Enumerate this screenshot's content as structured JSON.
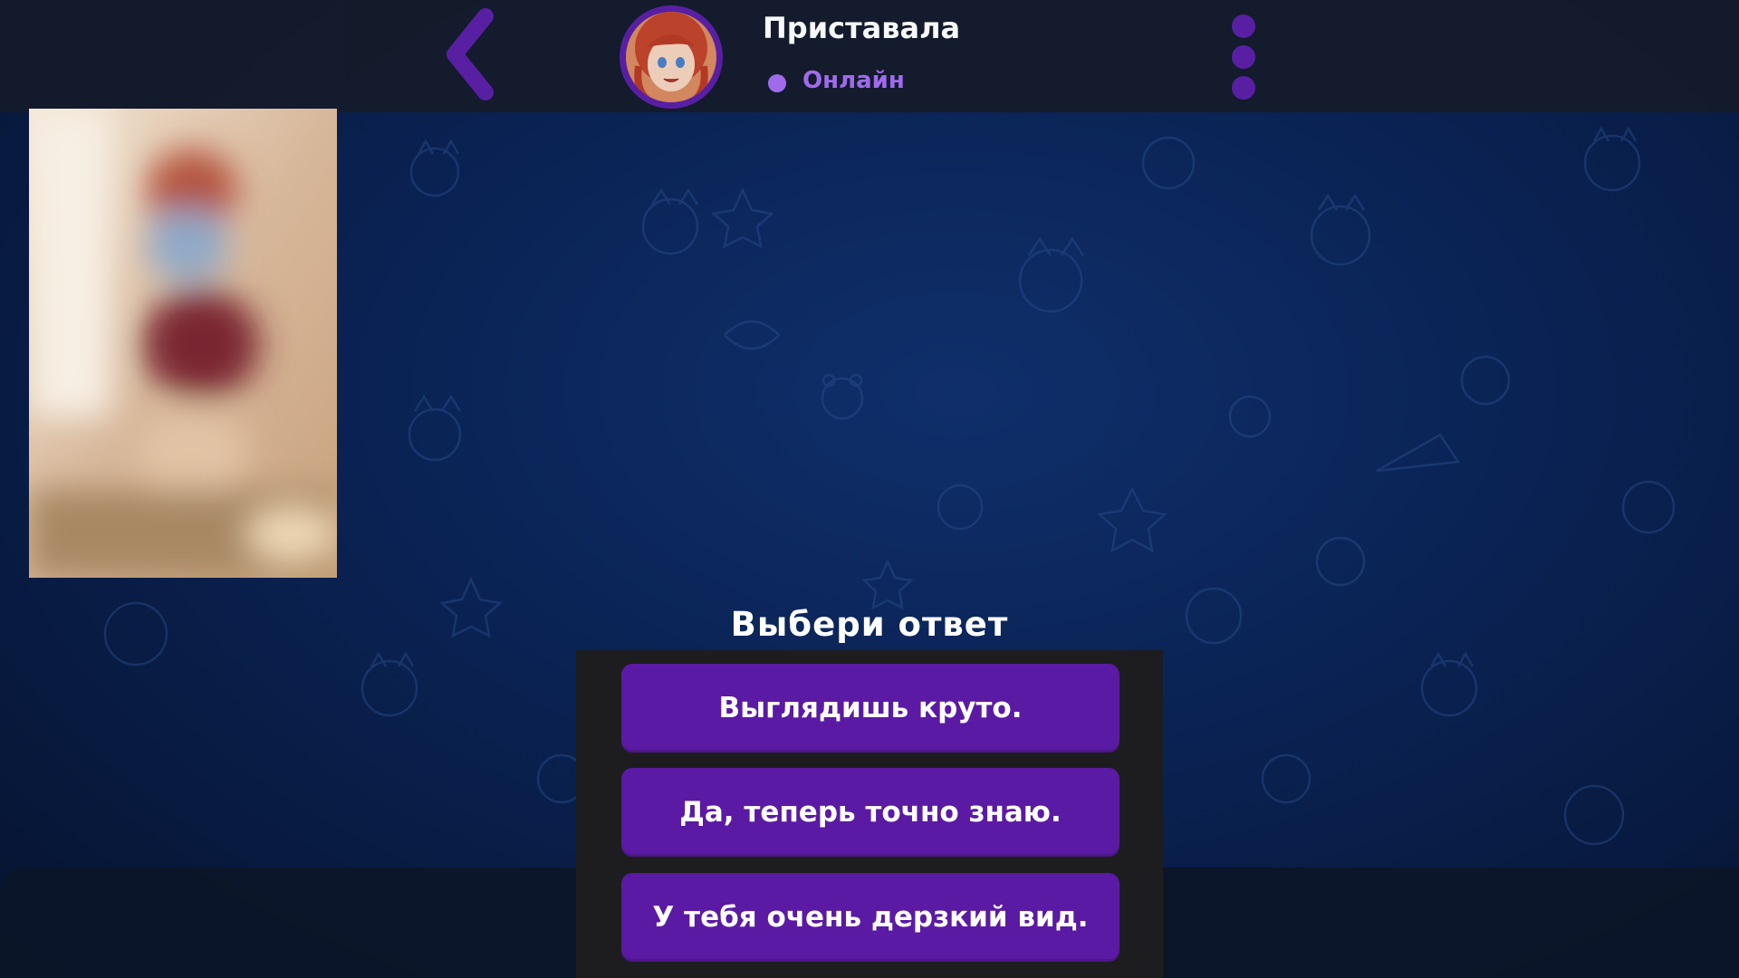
{
  "header": {
    "back_icon": "chevron-left-icon",
    "contact_name": "Приставала",
    "status": "Онлайн",
    "menu_icon": "vertical-dots-icon"
  },
  "photo": {
    "description_icon": "blurred-photo"
  },
  "choice": {
    "title": "Выбери ответ",
    "options": [
      "Выглядишь круто.",
      "Да, теперь точно знаю.",
      "У тебя очень дерзкий вид."
    ]
  },
  "colors": {
    "accent": "#5b1aa3",
    "status": "#a46ef0",
    "background": "#0a2253",
    "panel": "#1d1d1f"
  }
}
